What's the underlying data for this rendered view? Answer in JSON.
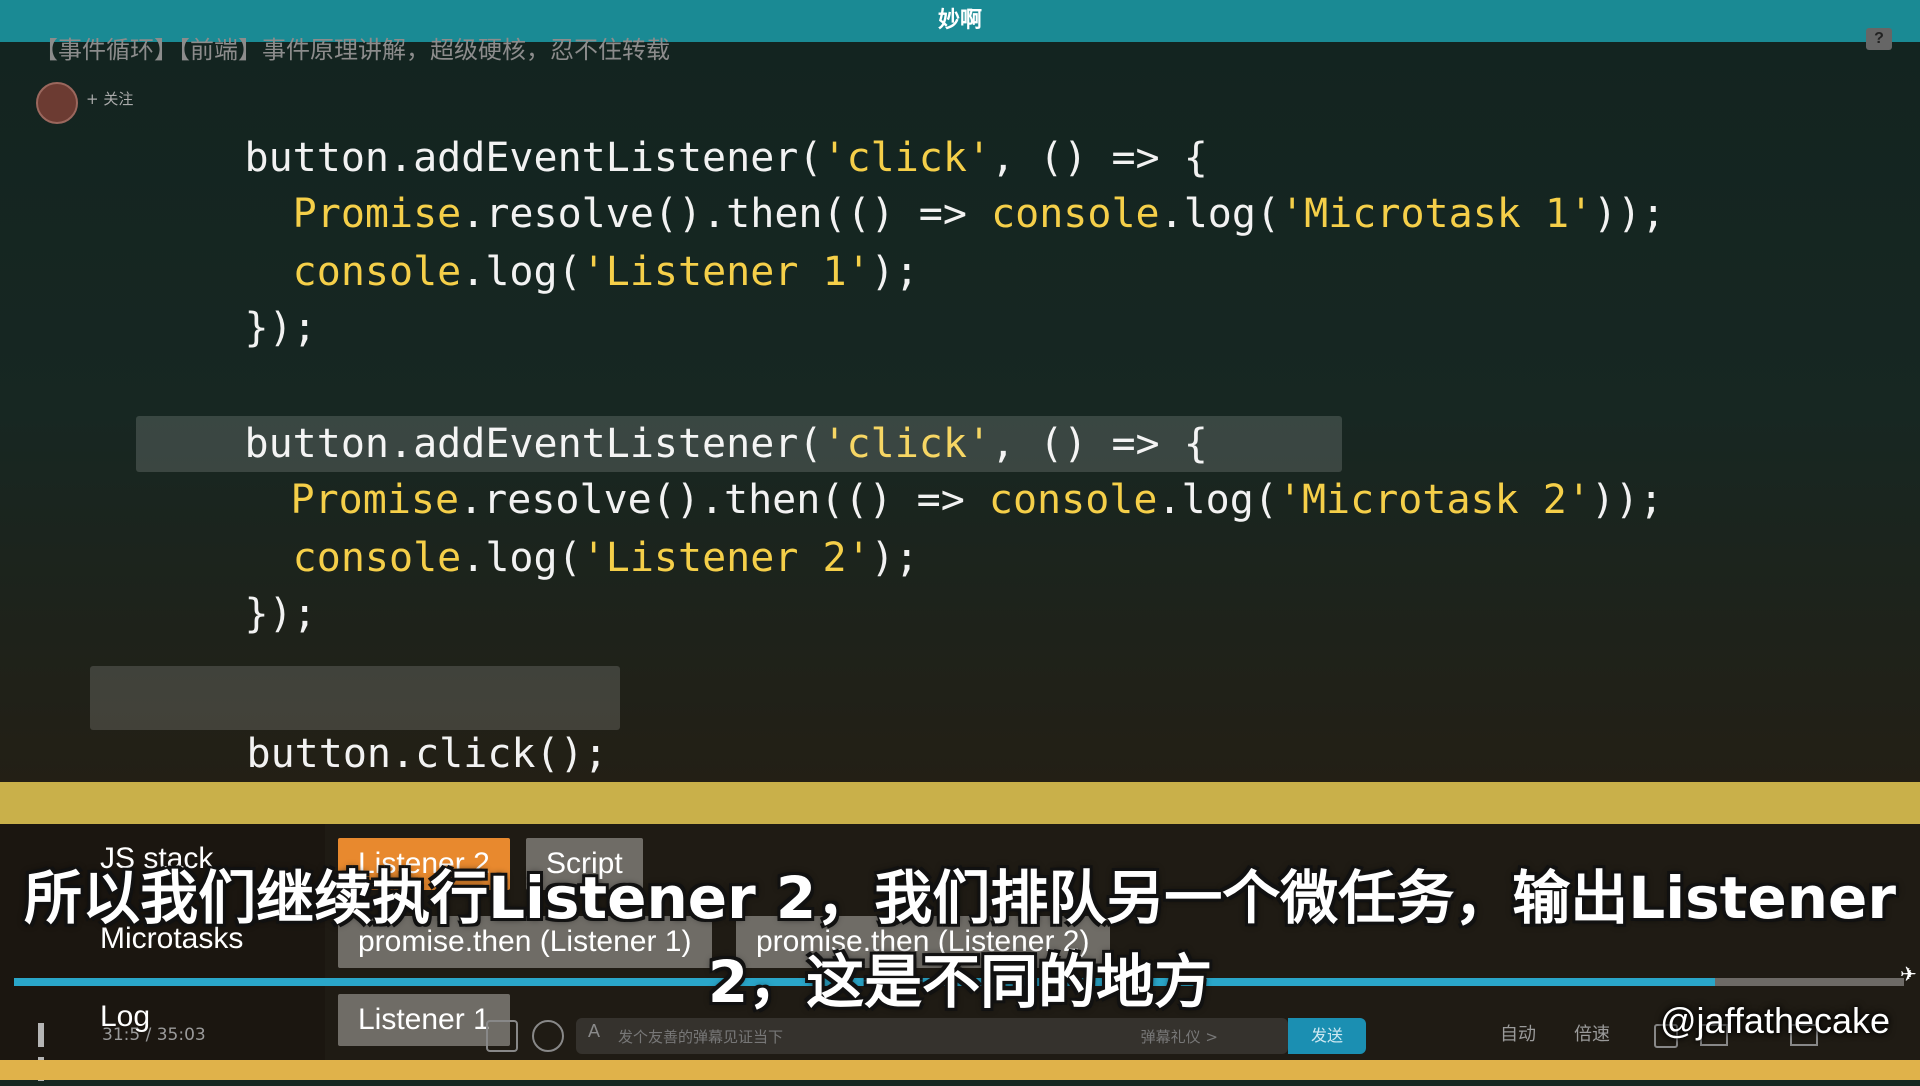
{
  "window": {
    "title": "妙啊"
  },
  "video": {
    "title": "【事件循环】【前端】事件原理讲解，超级硬核，忍不住转载",
    "follow_label": "+ 关注",
    "help_icon": "help-icon"
  },
  "slide": {
    "code_lines": [
      {
        "parts": [
          "button.addEventListener(",
          "'click'",
          ", () => {"
        ]
      },
      {
        "parts": [
          "  ",
          "Promise",
          ".resolve().then(() => ",
          "console",
          ".log(",
          "'Microtask 1'",
          "));"
        ]
      },
      {
        "parts": [
          "  ",
          "console",
          ".log(",
          "'Listener 1'",
          ");"
        ]
      },
      {
        "parts": [
          "});"
        ]
      },
      {
        "parts": [
          ""
        ]
      },
      {
        "parts": [
          "button.addEventListener(",
          "'click'",
          ", () => {"
        ]
      },
      {
        "parts": [
          "  ",
          "Promise",
          ".resolve().then(() => ",
          "console",
          ".log(",
          "'Microtask 2'",
          "));"
        ]
      },
      {
        "parts": [
          "  ",
          "console",
          ".log(",
          "'Listener 2'",
          ");"
        ]
      },
      {
        "parts": [
          "});"
        ]
      },
      {
        "parts": [
          ""
        ]
      },
      {
        "parts": [
          "button.click();"
        ]
      }
    ],
    "viz": {
      "js_stack_label": "JS stack",
      "js_stack": [
        "Listener 2",
        "Script"
      ],
      "microtasks_label": "Microtasks",
      "microtasks": [
        "promise.then (Listener 1)",
        "promise.then (Listener 2)"
      ],
      "log_label": "Log",
      "log": [
        "Listener 1"
      ]
    },
    "watermark": "@jaffathecake"
  },
  "subtitle": {
    "line1": "所以我们继续执行Listener 2，我们排队另一个微任务，输出Listener",
    "line2": "2，这是不同的地方"
  },
  "player": {
    "progress": 0.9,
    "time": "31:5 / 35:03",
    "danmaku_placeholder": "发个友善的弹幕见证当下",
    "danmaku_gift": "弹幕礼仪 >",
    "send_label": "发送",
    "auto_label": "自动",
    "speed_label": "倍速"
  },
  "colors": {
    "accent": "#1a8a94",
    "stack_active": "#e8892e",
    "string": "#f5cf49"
  }
}
